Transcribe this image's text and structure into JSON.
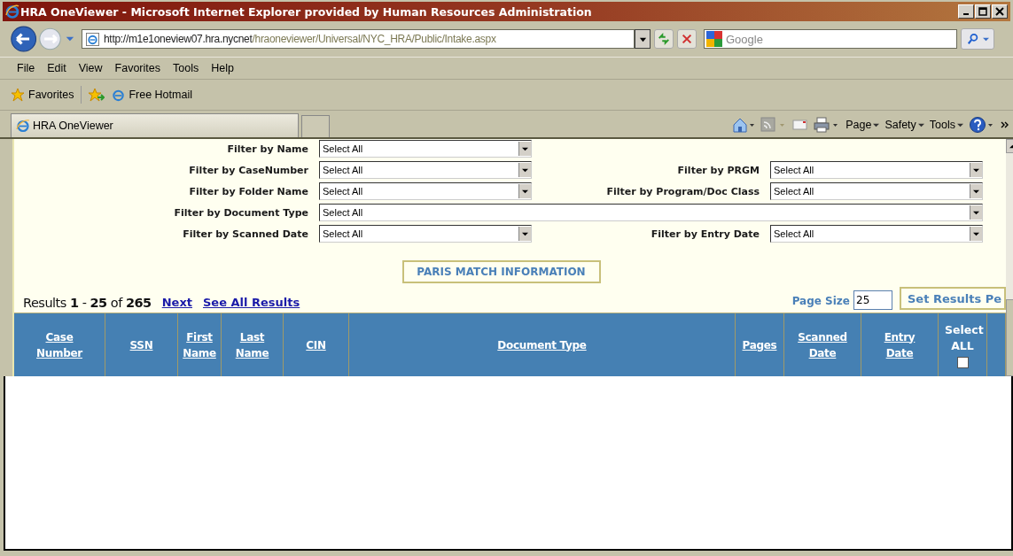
{
  "window": {
    "title": "HRA OneViewer - Microsoft Internet Explorer provided by Human Resources Administration"
  },
  "address_bar": {
    "url_host": "http://m1e1oneview07.hra.nycnet",
    "url_path": "/hraoneviewer/Universal/NYC_HRA/Public/Intake.aspx"
  },
  "search": {
    "placeholder": "Google"
  },
  "menu": [
    "File",
    "Edit",
    "View",
    "Favorites",
    "Tools",
    "Help"
  ],
  "favorites_bar": {
    "favorites": "Favorites",
    "links": [
      "Free Hotmail"
    ]
  },
  "tabs": [
    {
      "label": "HRA OneViewer",
      "selected": true
    }
  ],
  "command_bar": [
    "Page",
    "Safety",
    "Tools"
  ],
  "filter_rows": [
    {
      "items": [
        {
          "kind": "narrow",
          "label": "Filter by Name",
          "value": "Select All"
        }
      ]
    },
    {
      "items": [
        {
          "kind": "narrow",
          "label": "Filter by CaseNumber",
          "value": "Select All"
        },
        {
          "kind": "narrow",
          "label": "Filter by PRGM",
          "value": "Select All"
        }
      ]
    },
    {
      "items": [
        {
          "kind": "narrow",
          "label": "Filter by Folder Name",
          "value": "Select All"
        },
        {
          "kind": "narrow",
          "label": "Filter by Program/Doc Class",
          "value": "Select All"
        }
      ]
    },
    {
      "items": [
        {
          "kind": "wide",
          "label": "Filter by Document Type",
          "value": "Select All"
        }
      ]
    },
    {
      "items": [
        {
          "kind": "narrow",
          "label": "Filter by Scanned Date",
          "value": "Select All"
        },
        {
          "kind": "narrow",
          "label": "Filter by Entry Date",
          "value": "Select All"
        }
      ]
    }
  ],
  "paris_button": "PARIS MATCH INFORMATION",
  "results": {
    "summary": "Results **1** - **25** of **265**",
    "links": [
      "Next",
      "See All Results"
    ]
  },
  "page_size": {
    "label": "Page Size",
    "value": "25",
    "button": "Set Results Pe"
  },
  "table": {
    "columns": [
      {
        "kind": "link",
        "label": "Case Number"
      },
      {
        "kind": "link",
        "label": "SSN"
      },
      {
        "kind": "link",
        "label": "First Name"
      },
      {
        "kind": "link",
        "label": "Last Name"
      },
      {
        "kind": "link",
        "label": "CIN"
      },
      {
        "kind": "link",
        "label": "Document Type"
      },
      {
        "kind": "link",
        "label": "Pages"
      },
      {
        "kind": "link",
        "label": "Scanned Date"
      },
      {
        "kind": "link",
        "label": "Entry Date"
      },
      {
        "kind": "checkbox",
        "label": "Select ALL",
        "checked": false
      },
      {
        "kind": "blank"
      }
    ]
  }
}
